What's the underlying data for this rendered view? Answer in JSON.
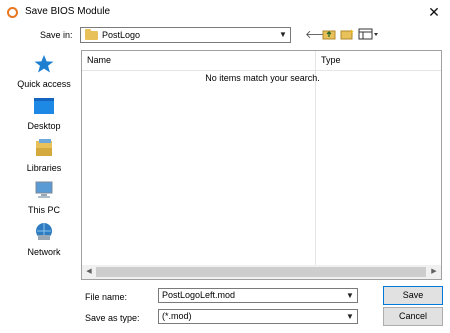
{
  "window": {
    "title": "Save BIOS Module",
    "close_glyph": "✕"
  },
  "save_in": {
    "label": "Save in:",
    "value": "PostLogo",
    "folder_icon": "folder-icon"
  },
  "toolbar": {
    "icons": [
      "back-arrow-icon",
      "up-folder-icon",
      "new-folder-icon",
      "view-menu-icon"
    ]
  },
  "places": [
    {
      "label": "Quick access",
      "icon": "star-icon",
      "color": "#1e7fd1"
    },
    {
      "label": "Desktop",
      "icon": "desktop-icon",
      "color": "#1e88e5"
    },
    {
      "label": "Libraries",
      "icon": "libraries-icon",
      "color": "#e8c15a"
    },
    {
      "label": "This PC",
      "icon": "computer-icon",
      "color": "#5a9bd5"
    },
    {
      "label": "Network",
      "icon": "network-icon",
      "color": "#2d7cc1"
    }
  ],
  "file_list": {
    "columns": [
      "Name",
      "Type"
    ],
    "empty_message": "No items match your search."
  },
  "file_name": {
    "label": "File name:",
    "value": "PostLogoLeft.mod"
  },
  "save_as_type": {
    "label": "Save as type:",
    "value": "(*.mod)"
  },
  "buttons": {
    "save": "Save",
    "cancel": "Cancel"
  },
  "colors": {
    "accent": "#0078d7",
    "app_icon": "#e87722"
  }
}
